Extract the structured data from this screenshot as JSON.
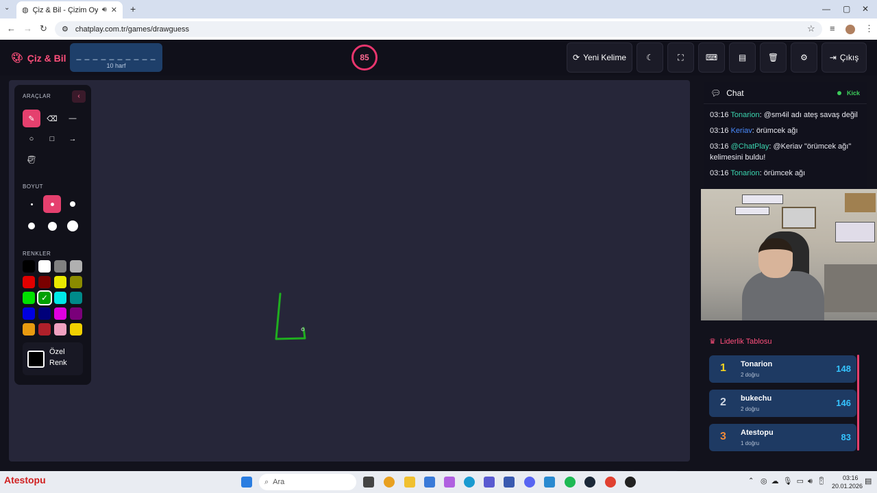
{
  "browser": {
    "tab_title": "Çiz & Bil - Çizim Oyunu",
    "url": "chatplay.com.tr/games/drawguess"
  },
  "header": {
    "logo": "Çiz & Bil",
    "word_mask": "_ _ _ _ _ _ _ _ _ _",
    "word_length": "10 harf",
    "timer": "85",
    "new_word": "Yeni Kelime",
    "exit": "Çıkış"
  },
  "tools": {
    "section_tools": "ARAÇLAR",
    "section_size": "BOYUT",
    "section_colors": "RENKLER",
    "custom_color_1": "Özel",
    "custom_color_2": "Renk"
  },
  "colors": {
    "accent": "#e5406e",
    "swatches": [
      "#000000",
      "#ffffff",
      "#808080",
      "#b0b0b0",
      "#e00000",
      "#7a0000",
      "#e8e800",
      "#8a8a00",
      "#00e000",
      "#00a000",
      "#00e8e8",
      "#008a8a",
      "#0000e0",
      "#00007a",
      "#e000e0",
      "#7a007a",
      "#e89a10",
      "#b0202a",
      "#f0a0c0",
      "#f0d000"
    ],
    "stroke": "#1fae1f"
  },
  "chat": {
    "title": "Chat",
    "platform": "Kick",
    "messages": [
      {
        "time": "03:16",
        "user": "Tonarion",
        "user_color": "#3bd6b0",
        "text": ": @sm4il adı ateş savaş değil"
      },
      {
        "time": "03:16",
        "user": "Keriav",
        "user_color": "#4a8cff",
        "text": ": örümcek ağı"
      },
      {
        "time": "03:16",
        "user": "@ChatPlay",
        "user_color": "#3bd6b0",
        "text": ": @Keriav \"örümcek ağı\" kelimesini buldu!"
      },
      {
        "time": "03:16",
        "user": "Tonarion",
        "user_color": "#3bd6b0",
        "text": ": örümcek ağı"
      }
    ]
  },
  "leaderboard": {
    "title": "Liderlik Tablosu",
    "rows": [
      {
        "rank": "1",
        "name": "Tonarion",
        "correct": "2 doğru",
        "score": "148",
        "rank_color": "#f5d320"
      },
      {
        "rank": "2",
        "name": "bukechu",
        "correct": "2 doğru",
        "score": "146",
        "rank_color": "#d0d8e4"
      },
      {
        "rank": "3",
        "name": "Atestopu",
        "correct": "1 doğru",
        "score": "83",
        "rank_color": "#f08a3a"
      }
    ]
  },
  "taskbar": {
    "search": "Ara",
    "time": "03:16",
    "date": "20.01.2026",
    "left_label": "Atestopu"
  }
}
